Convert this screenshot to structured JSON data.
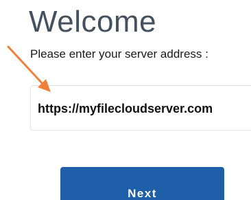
{
  "header": {
    "title": "Welcome",
    "prompt": "Please enter your server address :"
  },
  "server_field": {
    "value": "https://myfilecloudserver.com",
    "placeholder": ""
  },
  "actions": {
    "next_label": "Next"
  },
  "colors": {
    "title": "#44505d",
    "accent": "#1f5ea8",
    "annotation_arrow": "#f07f3c",
    "field_border": "#e2e5e8"
  },
  "annotation": {
    "icon": "arrow-pointer-icon"
  }
}
